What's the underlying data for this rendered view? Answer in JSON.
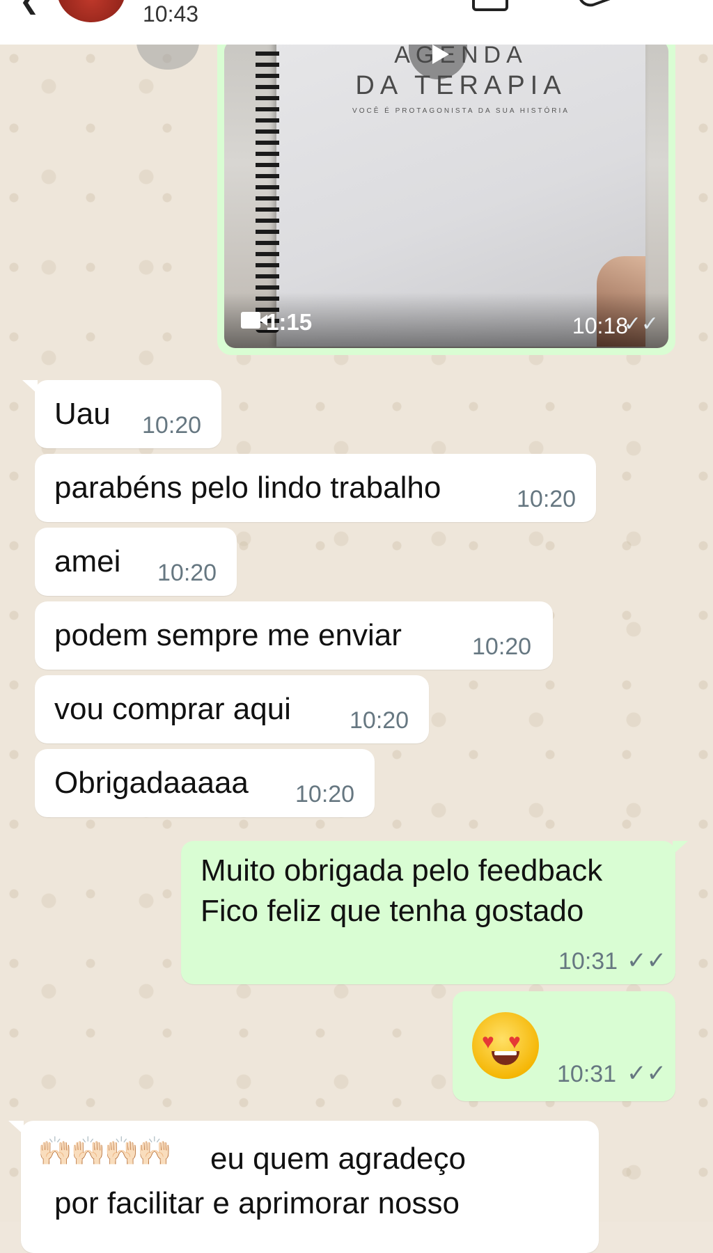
{
  "header": {
    "time": "10:43",
    "back_icon": "arrow-left-icon",
    "actions": [
      "video-call-icon",
      "phone-icon",
      "more-vert-icon"
    ]
  },
  "video_message": {
    "notebook_title_line1": "AGENDA",
    "notebook_title_line2": "DA TERAPIA",
    "notebook_subtitle": "VOCÊ É PROTAGONISTA DA SUA HISTÓRIA",
    "duration": "1:15",
    "time": "10:18",
    "ticks": "✓✓"
  },
  "messages": [
    {
      "direction": "in",
      "text": "Uau",
      "time": "10:20"
    },
    {
      "direction": "in",
      "text": "parabéns pelo lindo trabalho",
      "time": "10:20"
    },
    {
      "direction": "in",
      "text": "amei",
      "time": "10:20"
    },
    {
      "direction": "in",
      "text": "podem sempre me enviar",
      "time": "10:20"
    },
    {
      "direction": "in",
      "text": "vou comprar aqui",
      "time": "10:20"
    },
    {
      "direction": "in",
      "text": "Obrigadaaaaa",
      "time": "10:20"
    },
    {
      "direction": "out",
      "line1": "Muito obrigada pelo feedback",
      "line2": "Fico feliz que tenha gostado",
      "time": "10:31",
      "ticks": "✓✓"
    },
    {
      "direction": "out",
      "emoji": "smiling-face-with-heart-eyes",
      "time": "10:31",
      "ticks": "✓✓"
    },
    {
      "direction": "in",
      "emoji_prefix": "🙌🏻🙌🏻🙌🏻🙌🏻",
      "line1": "eu quem agradeço",
      "line2": "por facilitar e aprimorar nosso"
    }
  ],
  "colors": {
    "incoming_bubble": "#ffffff",
    "outgoing_bubble": "#d9fdd3",
    "wallpaper": "#eee6da",
    "timestamp": "#667781"
  }
}
